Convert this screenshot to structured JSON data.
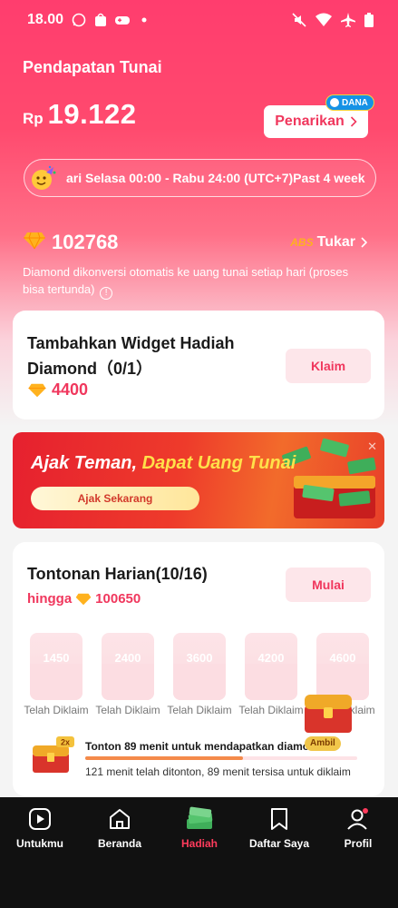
{
  "status_bar": {
    "time": "18.00",
    "icons_left": [
      "whatsapp-icon",
      "shopee-icon",
      "gamepad-icon",
      "dot-icon"
    ],
    "icons_right": [
      "mute-icon",
      "wifi-icon",
      "airplane-icon",
      "battery-icon"
    ]
  },
  "cash": {
    "title": "Pendapatan Tunai",
    "currency": "Rp",
    "amount": "19.122",
    "withdraw_label": "Penarikan",
    "withdraw_badge": "DANA"
  },
  "period_bar": {
    "text": "ari Selasa 00:00 - Rabu 24:00 (UTC+7)Past 4 week"
  },
  "diamonds": {
    "count": "102768",
    "exchange_badge": "ABS",
    "exchange_label": "Tukar",
    "note": "Diamond dikonversi otomatis ke uang tunai setiap hari (proses bisa tertunda)"
  },
  "widget_task": {
    "title": "Tambahkan Widget Hadiah Diamond（0/1）",
    "reward": "4400",
    "claim_label": "Klaim"
  },
  "banner": {
    "title_part1": "Ajak Teman,",
    "title_part2": "Dapat Uang Tunai",
    "button_label": "Ajak Sekarang"
  },
  "daily": {
    "title": "Tontonan Harian(10/16)",
    "sub_prefix": "hingga",
    "sub_value": "100650",
    "start_label": "Mulai",
    "rewards": [
      {
        "amount": "1450",
        "label": "Telah Diklaim"
      },
      {
        "amount": "2400",
        "label": "Telah Diklaim"
      },
      {
        "amount": "3600",
        "label": "Telah Diklaim"
      },
      {
        "amount": "4200",
        "label": "Telah Diklaim"
      },
      {
        "amount": "4600",
        "label": "Telah Diklaim"
      }
    ],
    "progress_text": "Tonton 89 menit untuk mendapatkan diamond",
    "progress_fraction": 0.58,
    "progress_sub": "121 menit telah ditonton, 89 menit tersisa untuk diklaim",
    "chest_small_badge": "2x",
    "chest_big_badge": "Ambil"
  },
  "nav": {
    "items": [
      {
        "label": "Untukmu",
        "icon": "play-icon"
      },
      {
        "label": "Beranda",
        "icon": "home-icon"
      },
      {
        "label": "Hadiah",
        "icon": "money-stack-icon"
      },
      {
        "label": "Daftar Saya",
        "icon": "bookmark-icon"
      },
      {
        "label": "Profil",
        "icon": "profile-icon"
      }
    ],
    "active_index": 2
  },
  "colors": {
    "accent": "#f0375d",
    "header_gradient_top": "#ff3d6e",
    "nav_active": "#ff3b5c"
  }
}
